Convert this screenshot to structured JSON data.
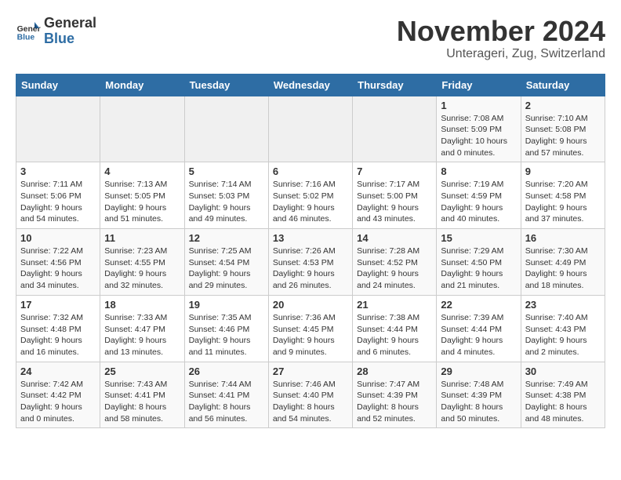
{
  "logo": {
    "general": "General",
    "blue": "Blue"
  },
  "title": "November 2024",
  "subtitle": "Unterageri, Zug, Switzerland",
  "days_header": [
    "Sunday",
    "Monday",
    "Tuesday",
    "Wednesday",
    "Thursday",
    "Friday",
    "Saturday"
  ],
  "weeks": [
    [
      {
        "day": "",
        "info": ""
      },
      {
        "day": "",
        "info": ""
      },
      {
        "day": "",
        "info": ""
      },
      {
        "day": "",
        "info": ""
      },
      {
        "day": "",
        "info": ""
      },
      {
        "day": "1",
        "info": "Sunrise: 7:08 AM\nSunset: 5:09 PM\nDaylight: 10 hours and 0 minutes."
      },
      {
        "day": "2",
        "info": "Sunrise: 7:10 AM\nSunset: 5:08 PM\nDaylight: 9 hours and 57 minutes."
      }
    ],
    [
      {
        "day": "3",
        "info": "Sunrise: 7:11 AM\nSunset: 5:06 PM\nDaylight: 9 hours and 54 minutes."
      },
      {
        "day": "4",
        "info": "Sunrise: 7:13 AM\nSunset: 5:05 PM\nDaylight: 9 hours and 51 minutes."
      },
      {
        "day": "5",
        "info": "Sunrise: 7:14 AM\nSunset: 5:03 PM\nDaylight: 9 hours and 49 minutes."
      },
      {
        "day": "6",
        "info": "Sunrise: 7:16 AM\nSunset: 5:02 PM\nDaylight: 9 hours and 46 minutes."
      },
      {
        "day": "7",
        "info": "Sunrise: 7:17 AM\nSunset: 5:00 PM\nDaylight: 9 hours and 43 minutes."
      },
      {
        "day": "8",
        "info": "Sunrise: 7:19 AM\nSunset: 4:59 PM\nDaylight: 9 hours and 40 minutes."
      },
      {
        "day": "9",
        "info": "Sunrise: 7:20 AM\nSunset: 4:58 PM\nDaylight: 9 hours and 37 minutes."
      }
    ],
    [
      {
        "day": "10",
        "info": "Sunrise: 7:22 AM\nSunset: 4:56 PM\nDaylight: 9 hours and 34 minutes."
      },
      {
        "day": "11",
        "info": "Sunrise: 7:23 AM\nSunset: 4:55 PM\nDaylight: 9 hours and 32 minutes."
      },
      {
        "day": "12",
        "info": "Sunrise: 7:25 AM\nSunset: 4:54 PM\nDaylight: 9 hours and 29 minutes."
      },
      {
        "day": "13",
        "info": "Sunrise: 7:26 AM\nSunset: 4:53 PM\nDaylight: 9 hours and 26 minutes."
      },
      {
        "day": "14",
        "info": "Sunrise: 7:28 AM\nSunset: 4:52 PM\nDaylight: 9 hours and 24 minutes."
      },
      {
        "day": "15",
        "info": "Sunrise: 7:29 AM\nSunset: 4:50 PM\nDaylight: 9 hours and 21 minutes."
      },
      {
        "day": "16",
        "info": "Sunrise: 7:30 AM\nSunset: 4:49 PM\nDaylight: 9 hours and 18 minutes."
      }
    ],
    [
      {
        "day": "17",
        "info": "Sunrise: 7:32 AM\nSunset: 4:48 PM\nDaylight: 9 hours and 16 minutes."
      },
      {
        "day": "18",
        "info": "Sunrise: 7:33 AM\nSunset: 4:47 PM\nDaylight: 9 hours and 13 minutes."
      },
      {
        "day": "19",
        "info": "Sunrise: 7:35 AM\nSunset: 4:46 PM\nDaylight: 9 hours and 11 minutes."
      },
      {
        "day": "20",
        "info": "Sunrise: 7:36 AM\nSunset: 4:45 PM\nDaylight: 9 hours and 9 minutes."
      },
      {
        "day": "21",
        "info": "Sunrise: 7:38 AM\nSunset: 4:44 PM\nDaylight: 9 hours and 6 minutes."
      },
      {
        "day": "22",
        "info": "Sunrise: 7:39 AM\nSunset: 4:44 PM\nDaylight: 9 hours and 4 minutes."
      },
      {
        "day": "23",
        "info": "Sunrise: 7:40 AM\nSunset: 4:43 PM\nDaylight: 9 hours and 2 minutes."
      }
    ],
    [
      {
        "day": "24",
        "info": "Sunrise: 7:42 AM\nSunset: 4:42 PM\nDaylight: 9 hours and 0 minutes."
      },
      {
        "day": "25",
        "info": "Sunrise: 7:43 AM\nSunset: 4:41 PM\nDaylight: 8 hours and 58 minutes."
      },
      {
        "day": "26",
        "info": "Sunrise: 7:44 AM\nSunset: 4:41 PM\nDaylight: 8 hours and 56 minutes."
      },
      {
        "day": "27",
        "info": "Sunrise: 7:46 AM\nSunset: 4:40 PM\nDaylight: 8 hours and 54 minutes."
      },
      {
        "day": "28",
        "info": "Sunrise: 7:47 AM\nSunset: 4:39 PM\nDaylight: 8 hours and 52 minutes."
      },
      {
        "day": "29",
        "info": "Sunrise: 7:48 AM\nSunset: 4:39 PM\nDaylight: 8 hours and 50 minutes."
      },
      {
        "day": "30",
        "info": "Sunrise: 7:49 AM\nSunset: 4:38 PM\nDaylight: 8 hours and 48 minutes."
      }
    ]
  ]
}
